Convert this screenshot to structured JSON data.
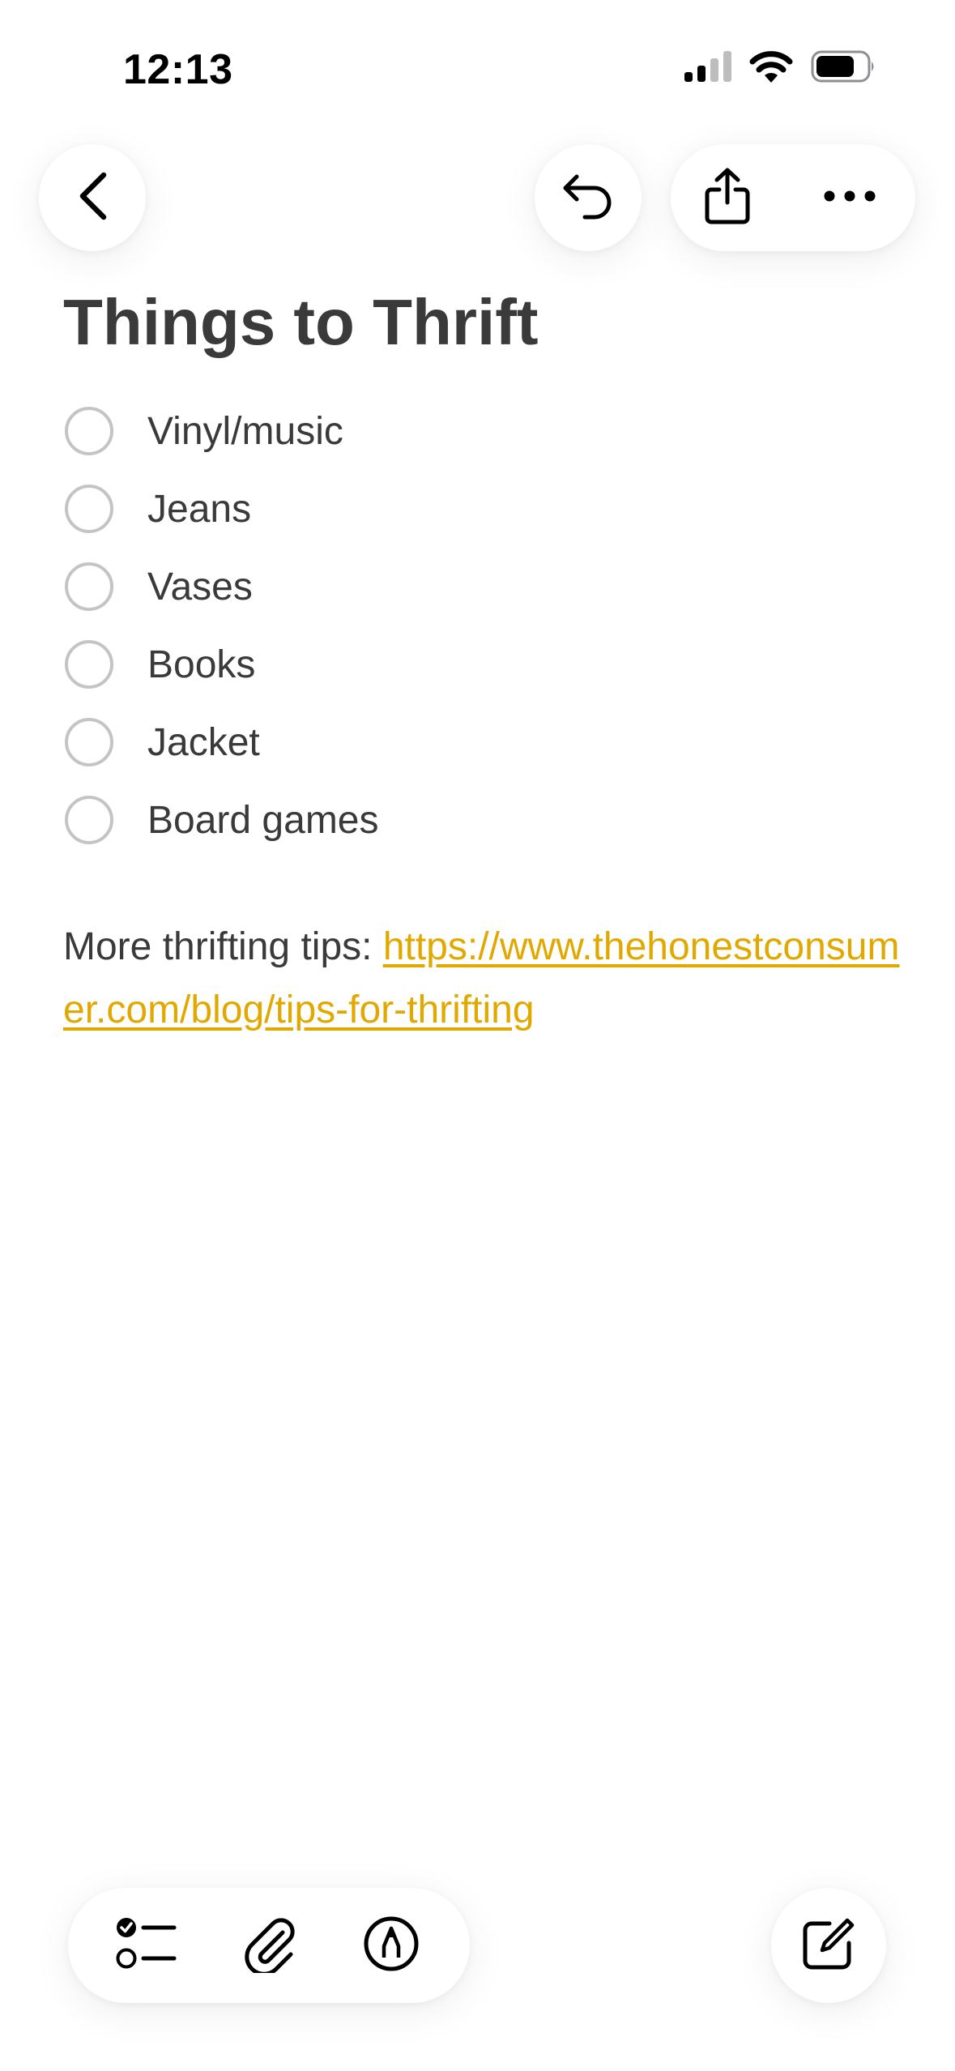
{
  "status_bar": {
    "time": "12:13",
    "icons": [
      "cellular-signal-icon",
      "wifi-icon",
      "battery-icon"
    ]
  },
  "nav": {
    "back_icon": "chevron-left-icon",
    "undo_icon": "undo-icon",
    "share_icon": "share-icon",
    "more_icon": "ellipsis-icon"
  },
  "note": {
    "title": "Things to Thrift",
    "checklist": [
      {
        "label": "Vinyl/music",
        "checked": false
      },
      {
        "label": "Jeans",
        "checked": false
      },
      {
        "label": "Vases",
        "checked": false
      },
      {
        "label": "Books",
        "checked": false
      },
      {
        "label": "Jacket",
        "checked": false
      },
      {
        "label": "Board games",
        "checked": false
      }
    ],
    "tips_prefix": "More thrifting tips: ",
    "tips_link": "https://www.thehonestconsumer.com/blog/tips-for-thrifting"
  },
  "toolbar": {
    "icons": [
      "checklist-icon",
      "paperclip-icon",
      "markup-pen-icon"
    ],
    "compose_icon": "compose-icon"
  },
  "colors": {
    "accent": "#e1a800",
    "text": "#3a3a3a",
    "checkbox_border": "#c4c4c6"
  }
}
